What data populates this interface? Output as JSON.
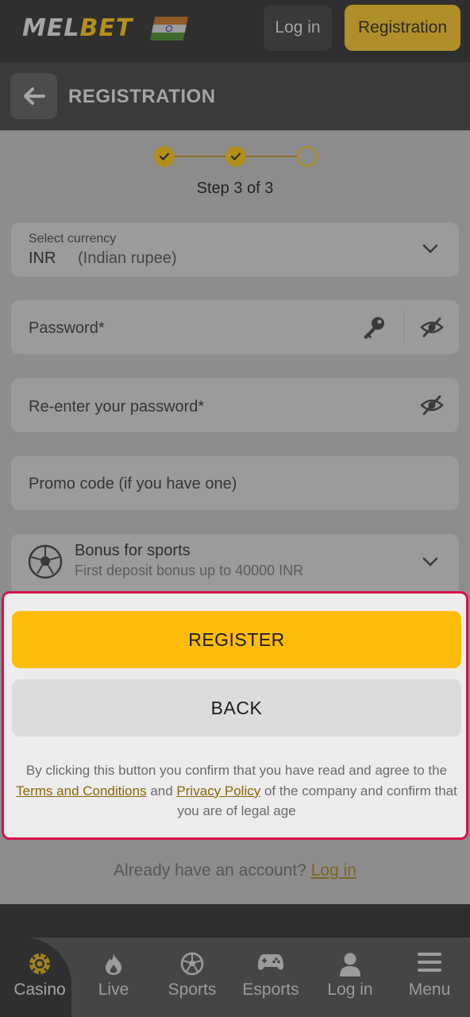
{
  "header": {
    "logo_prefix": "MEL",
    "logo_suffix": "BET",
    "login_label": "Log in",
    "registration_label": "Registration"
  },
  "titlebar": {
    "title": "REGISTRATION"
  },
  "steps": {
    "text": "Step 3 of 3",
    "current": 3,
    "total": 3
  },
  "form": {
    "currency_label": "Select currency",
    "currency_code": "INR",
    "currency_name": "(Indian rupee)",
    "password_placeholder": "Password*",
    "repassword_placeholder": "Re-enter your password*",
    "promo_placeholder": "Promo code (if you have one)",
    "bonus_title": "Bonus for sports",
    "bonus_subtitle": "First deposit bonus up to 40000 INR"
  },
  "actions": {
    "register_label": "REGISTER",
    "back_label": "BACK",
    "disclaimer_part1": "By clicking this button you confirm that you have read and agree to the",
    "terms_link": "Terms and Conditions",
    "and_text": "and",
    "privacy_link": "Privacy Policy",
    "disclaimer_part2": "of the company and confirm that you are of legal age"
  },
  "footer": {
    "already_text": "Already have an account?",
    "login_link": "Log in"
  },
  "bottom_nav": [
    {
      "label": "Casino",
      "icon": "casino-chip-icon",
      "active": true
    },
    {
      "label": "Live",
      "icon": "flame-icon",
      "active": false
    },
    {
      "label": "Sports",
      "icon": "soccer-ball-icon",
      "active": false
    },
    {
      "label": "Esports",
      "icon": "gamepad-icon",
      "active": false
    },
    {
      "label": "Log in",
      "icon": "user-icon",
      "active": false
    },
    {
      "label": "Menu",
      "icon": "hamburger-icon",
      "active": false
    }
  ],
  "colors": {
    "accent": "#fdbb0b",
    "highlight_border": "#d6124a"
  }
}
